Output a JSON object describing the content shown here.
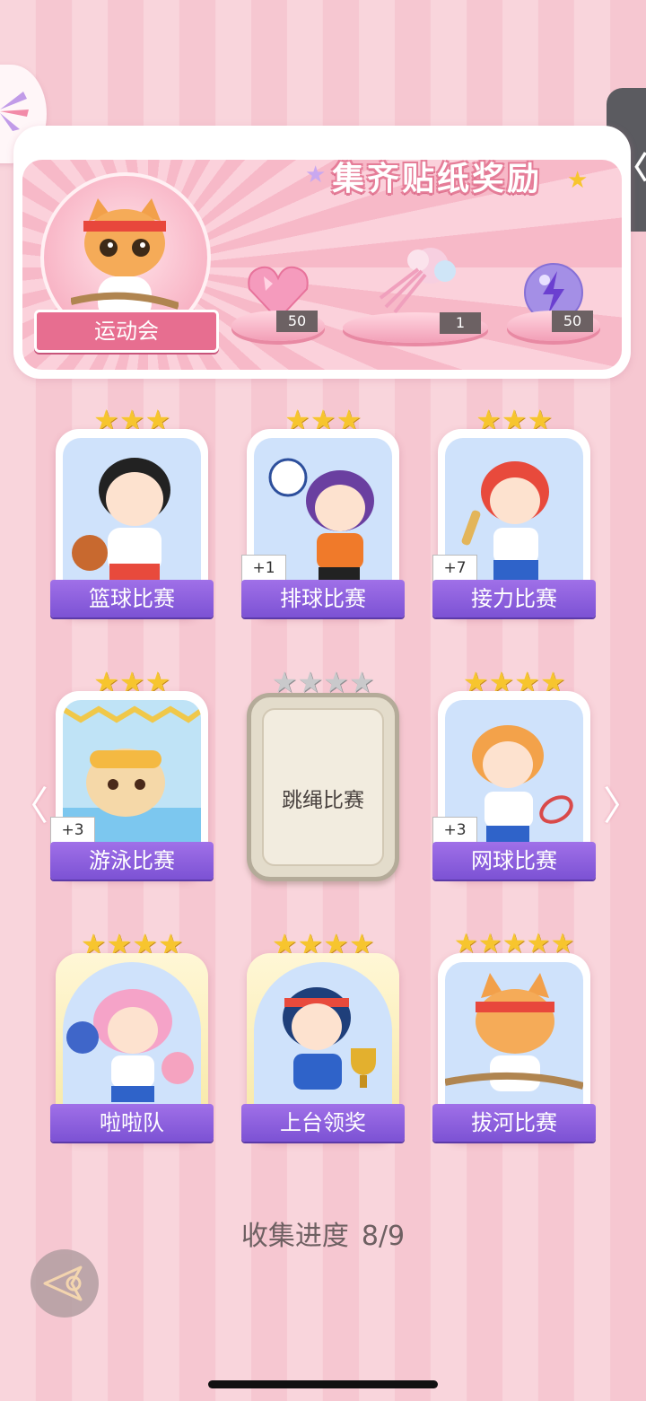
{
  "banner": {
    "title": "集齐贴纸奖励",
    "medallion_label": "运动会",
    "rewards": [
      {
        "name": "heart-gem",
        "count": "50"
      },
      {
        "name": "flower-bouquet",
        "count": "1"
      },
      {
        "name": "lightning-orb",
        "count": "50"
      }
    ]
  },
  "cards": [
    {
      "label": "篮球比赛",
      "stars": 3,
      "bonus": ""
    },
    {
      "label": "排球比赛",
      "stars": 3,
      "bonus": "+1"
    },
    {
      "label": "接力比赛",
      "stars": 3,
      "bonus": "+7"
    },
    {
      "label": "游泳比赛",
      "stars": 3,
      "bonus": "+3"
    },
    {
      "label": "跳绳比赛",
      "stars": 4,
      "bonus": "",
      "locked": true
    },
    {
      "label": "网球比赛",
      "stars": 4,
      "bonus": "+3"
    },
    {
      "label": "啦啦队",
      "stars": 4,
      "bonus": ""
    },
    {
      "label": "上台领奖",
      "stars": 4,
      "bonus": ""
    },
    {
      "label": "拔河比赛",
      "stars": 5,
      "bonus": ""
    }
  ],
  "progress": {
    "label": "收集进度",
    "value": "8/9",
    "collected": 8,
    "total": 9
  },
  "icons": {
    "side_tab": "chevron-left-icon",
    "prev": "arrow-left-icon",
    "next": "arrow-right-icon",
    "back": "back-icon"
  },
  "star_glyphs": {
    "three": "★★★",
    "four": "★★★★",
    "five": "★★★★★"
  },
  "nav": {
    "prev": "〈",
    "next": "〉",
    "tab": "〈"
  },
  "colors": {
    "label_purple": "#8a5ddc",
    "star_gold": "#f7c52e",
    "accent_pink": "#e76e90"
  }
}
